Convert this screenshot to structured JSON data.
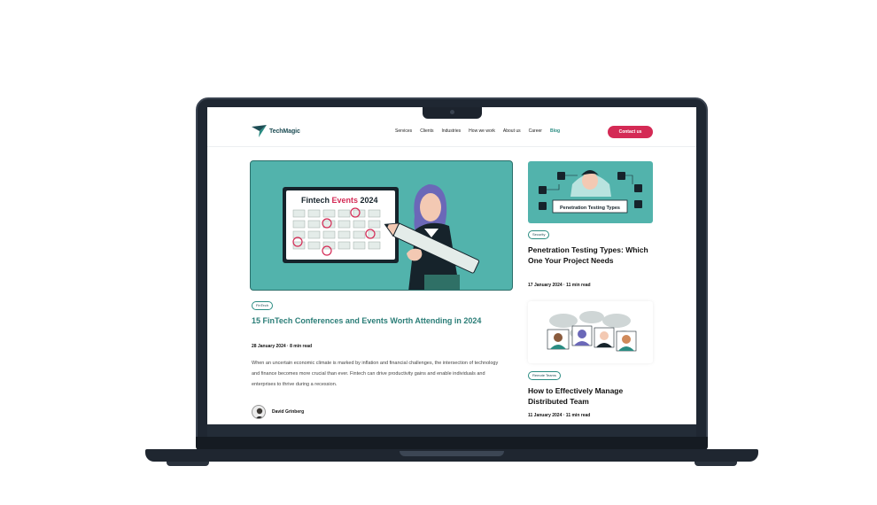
{
  "site": {
    "logo_text": "TechMagic",
    "nav": [
      "Services",
      "Clients",
      "Industries",
      "How we work",
      "About us",
      "Career",
      "Blog"
    ],
    "active_nav": "Blog",
    "contact_label": "Contact us"
  },
  "featured": {
    "image_heading_a": "Fintech ",
    "image_heading_b": "Events",
    "image_heading_c": " 2024",
    "tag": "FinTech",
    "title": "15 FinTech Conferences and Events Worth Attending in 2024",
    "meta": "28 January 2024 · 8 min read",
    "excerpt": "When an uncertain economic climate is marked by inflation and financial challenges, the intersection of technology and finance becomes more crucial than ever. Fintech can drive productivity gains and enable individuals and enterprises to thrive during a recession.",
    "author": "David Grinberg"
  },
  "side_posts": [
    {
      "image_label": "Penetration Testing Types",
      "tag": "Security",
      "title": "Penetration Testing Types: Which One Your Project Needs",
      "meta": "17 January 2024 · 11 min read"
    },
    {
      "tag": "Remote Teams",
      "title": "How to Effectively Manage Distributed Team",
      "meta": "11 January 2024 · 11 min read"
    }
  ],
  "colors": {
    "brand_teal": "#2a8c82",
    "hero_bg": "#52b3ac",
    "cta_red": "#d42a55",
    "laptop_body": "#1f2732"
  }
}
